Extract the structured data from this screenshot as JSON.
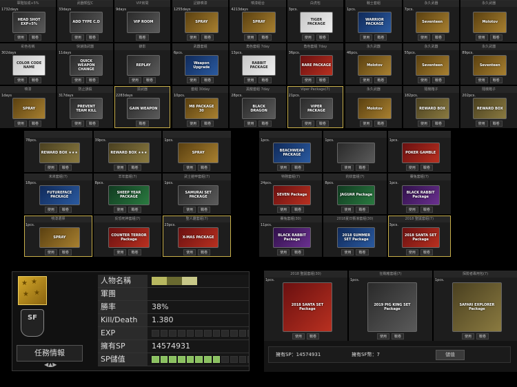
{
  "panelA": {
    "tiles": [
      {
        "title": "軍階加成+5%",
        "qty": "1732days",
        "card": "HEAD SHOT EXP+5%",
        "theme": "c-grey",
        "btns": [
          "使用",
          "戰卷"
        ]
      },
      {
        "title": "武器類型C",
        "qty": "33days",
        "card": "ADD TYPE C.D",
        "theme": "c-grey",
        "btns": [
          "使用",
          "戰卷"
        ]
      },
      {
        "title": "VIP房間",
        "qty": "9days",
        "card": "VIP ROOM",
        "theme": "c-grey",
        "btns": [
          "戰卷"
        ]
      },
      {
        "title": "彩色名稱",
        "qty": "302days",
        "card": "COLOR CODE NAME",
        "theme": "c-white",
        "btns": [
          "使用",
          "戰卷"
        ]
      },
      {
        "title": "快速換武器",
        "qty": "11days",
        "card": "QUICK WEAPON CHANGE",
        "theme": "c-grey",
        "btns": [
          "使用",
          "戰卷"
        ]
      },
      {
        "title": "錄影",
        "qty": "",
        "card": "REPLAY",
        "theme": "c-grey",
        "btns": [
          "使用",
          "戰卷"
        ]
      },
      {
        "title": "噴漆",
        "qty": "1days",
        "card": "SPRAY",
        "theme": "c-gold",
        "btns": [
          "使用",
          "戰卷"
        ]
      },
      {
        "title": "防止誤殺",
        "qty": "317days",
        "card": "PREVENT TEAM KILL",
        "theme": "c-grey",
        "btns": [
          "使用",
          "戰卷"
        ]
      },
      {
        "title": "撿武器",
        "qty": "2283days",
        "card": "GAIN WEAPON",
        "theme": "c-grey",
        "btns": [
          "戰卷"
        ],
        "sel": true
      }
    ]
  },
  "panelB": {
    "tiles": [
      {
        "title": "記錄噴漆",
        "qty": "1255days",
        "card": "SPRAY",
        "theme": "c-gold",
        "btns": [
          "使用",
          "戰卷"
        ]
      },
      {
        "title": "噴漆組合",
        "qty": "4213days",
        "card": "SPRAY",
        "theme": "c-gold",
        "btns": [
          "使用",
          "戰卷"
        ]
      },
      {
        "title": "白虎包",
        "qty": "3pcs.",
        "card": "TIGER PACKAGE",
        "theme": "c-white",
        "btns": [
          "使用",
          "戰卷"
        ]
      },
      {
        "title": "武器套組",
        "qty": "6pcs.",
        "card": "Weapon Upgrade",
        "theme": "c-blue",
        "btns": [
          "使用",
          "戰卷"
        ]
      },
      {
        "title": "角色套組 7day",
        "qty": "13pcs.",
        "card": "RABBIT PACKAGE",
        "theme": "c-white",
        "btns": [
          "使用",
          "戰卷"
        ]
      },
      {
        "title": "角色套組 7day",
        "qty": "36pcs.",
        "card": "RARE PACKAGE",
        "theme": "c-red",
        "btns": [
          "使用",
          "戰卷"
        ]
      },
      {
        "title": "套組 30day",
        "qty": "10pcs.",
        "card": "M8 PACKAGE 30",
        "theme": "c-gold",
        "btns": [
          "使用",
          "戰卷"
        ]
      },
      {
        "title": "黑龍套組 7day",
        "qty": "28pcs.",
        "card": "BLACK DRAGON",
        "theme": "c-grey",
        "btns": [
          "使用",
          "戰卷"
        ]
      },
      {
        "title": "Viper Package(7)",
        "qty": "21pcs.",
        "card": "VIPER PACKAGE",
        "theme": "c-grey",
        "btns": [
          "使用",
          "戰卷"
        ],
        "sel": true
      }
    ]
  },
  "panelC": {
    "tiles": [
      {
        "title": "戰士套組",
        "qty": "1pcs.",
        "card": "WARRIOR PACKAGE",
        "theme": "c-blue",
        "btns": [
          "使用",
          "戰卷"
        ]
      },
      {
        "title": "永久武器",
        "qty": "7pcs.",
        "card": "Seventeen",
        "theme": "c-gold",
        "btns": [
          "使用",
          "戰卷"
        ]
      },
      {
        "title": "永久武器",
        "qty": "",
        "card": "Molotov",
        "theme": "c-gold",
        "btns": [
          "使用",
          "戰卷"
        ]
      },
      {
        "title": "永久武器",
        "qty": "46pcs.",
        "card": "Molotov",
        "theme": "c-gold",
        "btns": [
          "使用",
          "戰卷"
        ]
      },
      {
        "title": "永久武器",
        "qty": "55pcs.",
        "card": "Seventeen",
        "theme": "c-gold",
        "btns": [
          "使用",
          "戰卷"
        ]
      },
      {
        "title": "永久武器",
        "qty": "89pcs.",
        "card": "Seventeen",
        "theme": "c-gold",
        "btns": [
          "使用",
          "戰卷"
        ]
      },
      {
        "title": "永久武器",
        "qty": "",
        "card": "Molotov",
        "theme": "c-gold",
        "btns": [
          "使用",
          "戰卷"
        ]
      },
      {
        "title": "隨機箱子",
        "qty": "182pcs.",
        "card": "REWARD BOX",
        "theme": "c-khaki",
        "btns": [
          "使用",
          "戰卷"
        ]
      },
      {
        "title": "隨機箱子",
        "qty": "202pcs.",
        "card": "REWARD BOX",
        "theme": "c-khaki",
        "btns": [
          "使用",
          "戰卷"
        ]
      }
    ]
  },
  "panelD": {
    "tiles": [
      {
        "title": "",
        "qty": "78pcs.",
        "card": "REWARD BOX ★★★",
        "theme": "c-khaki",
        "btns": [
          "使用",
          "戰卷"
        ]
      },
      {
        "title": "",
        "qty": "39pcs.",
        "card": "REWARD BOX ★★★",
        "theme": "c-khaki",
        "btns": [
          "使用",
          "戰卷"
        ]
      },
      {
        "title": "",
        "qty": "1pcs.",
        "card": "SPRAY",
        "theme": "c-gold",
        "btns": [
          "使用",
          "戰卷"
        ]
      },
      {
        "title": "未來套組(7)",
        "qty": "18pcs.",
        "card": "FUTUREFACE PACKAGE",
        "theme": "c-blue",
        "btns": [
          "使用",
          "戰卷"
        ]
      },
      {
        "title": "羊年套組(7)",
        "qty": "8pcs.",
        "card": "SHEEP YEAR PACKAGE",
        "theme": "c-green",
        "btns": [
          "使用",
          "戰卷"
        ]
      },
      {
        "title": "武士鎧甲套組(7)",
        "qty": "1pcs.",
        "card": "SAMURAI SET PACKAGE",
        "theme": "c-grey",
        "btns": [
          "使用",
          "戰卷"
        ]
      },
      {
        "title": "噴漆選擇",
        "qty": "1pcs.",
        "card": "SPRAY",
        "theme": "c-gold",
        "btns": [
          "使用",
          "戰卷"
        ],
        "sel": true
      },
      {
        "title": "反恐死神套組(7)",
        "qty": "",
        "card": "COUNTER TERROR Package",
        "theme": "c-red",
        "btns": [
          "使用",
          "戰卷"
        ]
      },
      {
        "title": "聖人雞套組(7)",
        "qty": "23pcs.",
        "card": "X-MAS PACKAGE",
        "theme": "c-red",
        "btns": [
          "使用",
          "戰卷"
        ],
        "sel": true
      }
    ]
  },
  "panelE": {
    "tiles": [
      {
        "title": "",
        "qty": "1pcs.",
        "card": "BEACHWEAR PACKAGE",
        "theme": "c-blue",
        "btns": [
          "使用",
          "戰卷"
        ]
      },
      {
        "title": "",
        "qty": "1pcs.",
        "card": "",
        "theme": "c-grey",
        "btns": [
          "使用",
          "戰卷"
        ]
      },
      {
        "title": "",
        "qty": "1pcs.",
        "card": "POKER GAMBLE",
        "theme": "c-red",
        "btns": [
          "使用",
          "戰卷"
        ]
      },
      {
        "title": "特務套組(7)",
        "qty": "24pcs.",
        "card": "SEVEN Package",
        "theme": "c-red",
        "btns": [
          "使用",
          "戰卷"
        ]
      },
      {
        "title": "豹紋套組(7)",
        "qty": "8pcs.",
        "card": "JAGUAR Package",
        "theme": "c-green",
        "btns": [
          "使用",
          "戰卷"
        ]
      },
      {
        "title": "賽兔套組(7)",
        "qty": "1pcs.",
        "card": "BLACK RABBIT Package",
        "theme": "c-purple",
        "btns": [
          "使用",
          "戰卷"
        ]
      },
      {
        "title": "賽兔套組(30)",
        "qty": "11pcs.",
        "card": "BLACK RABBIT Package",
        "theme": "c-purple",
        "btns": [
          "使用",
          "戰卷"
        ]
      },
      {
        "title": "2018夏日衝浪套組(30)",
        "qty": "",
        "card": "2018 SUMMER SET Package",
        "theme": "c-blue",
        "btns": [
          "使用",
          "戰卷"
        ]
      },
      {
        "title": "2018 聖誕套組(7)",
        "qty": "3pcs.",
        "card": "2018 SANTA SET Package",
        "theme": "c-red",
        "btns": [
          "使用",
          "戰卷"
        ],
        "sel": true
      }
    ]
  },
  "profile": {
    "rank_text": "SF",
    "mission_label": "任務情報",
    "rows": [
      {
        "label": "人物名稱",
        "value": ""
      },
      {
        "label": "軍團",
        "value": ""
      },
      {
        "label": "勝率",
        "value": "38%"
      },
      {
        "label": "Kill/Death",
        "value": "1.380"
      },
      {
        "label": "EXP",
        "value": ""
      },
      {
        "label": "擁有SP",
        "value": "14574931"
      },
      {
        "label": "SP儲值",
        "value": ""
      }
    ],
    "exp_level": 0,
    "sp_level": 0.7
  },
  "shop": {
    "tiles": [
      {
        "title": "2018 聖誕套組(30)",
        "qty": "1pcs.",
        "card": "2018 SANTA SET Package",
        "theme": "c-red",
        "btns": [
          "使用",
          "戰卷"
        ]
      },
      {
        "title": "狂戰豬套組(7)",
        "qty": "1pcs.",
        "card": "2019 PIG KING SET Package",
        "theme": "c-grey",
        "btns": [
          "使用",
          "戰卷"
        ]
      },
      {
        "title": "探險者專用包(7)",
        "qty": "1pcs.",
        "card": "SAFARI EXPLORER Package",
        "theme": "c-khaki",
        "btns": [
          "使用",
          "戰卷"
        ]
      }
    ],
    "sp_label": "擁有SP：14574931",
    "sf_label": "擁有SF幣：7",
    "save_label": "儲值"
  }
}
